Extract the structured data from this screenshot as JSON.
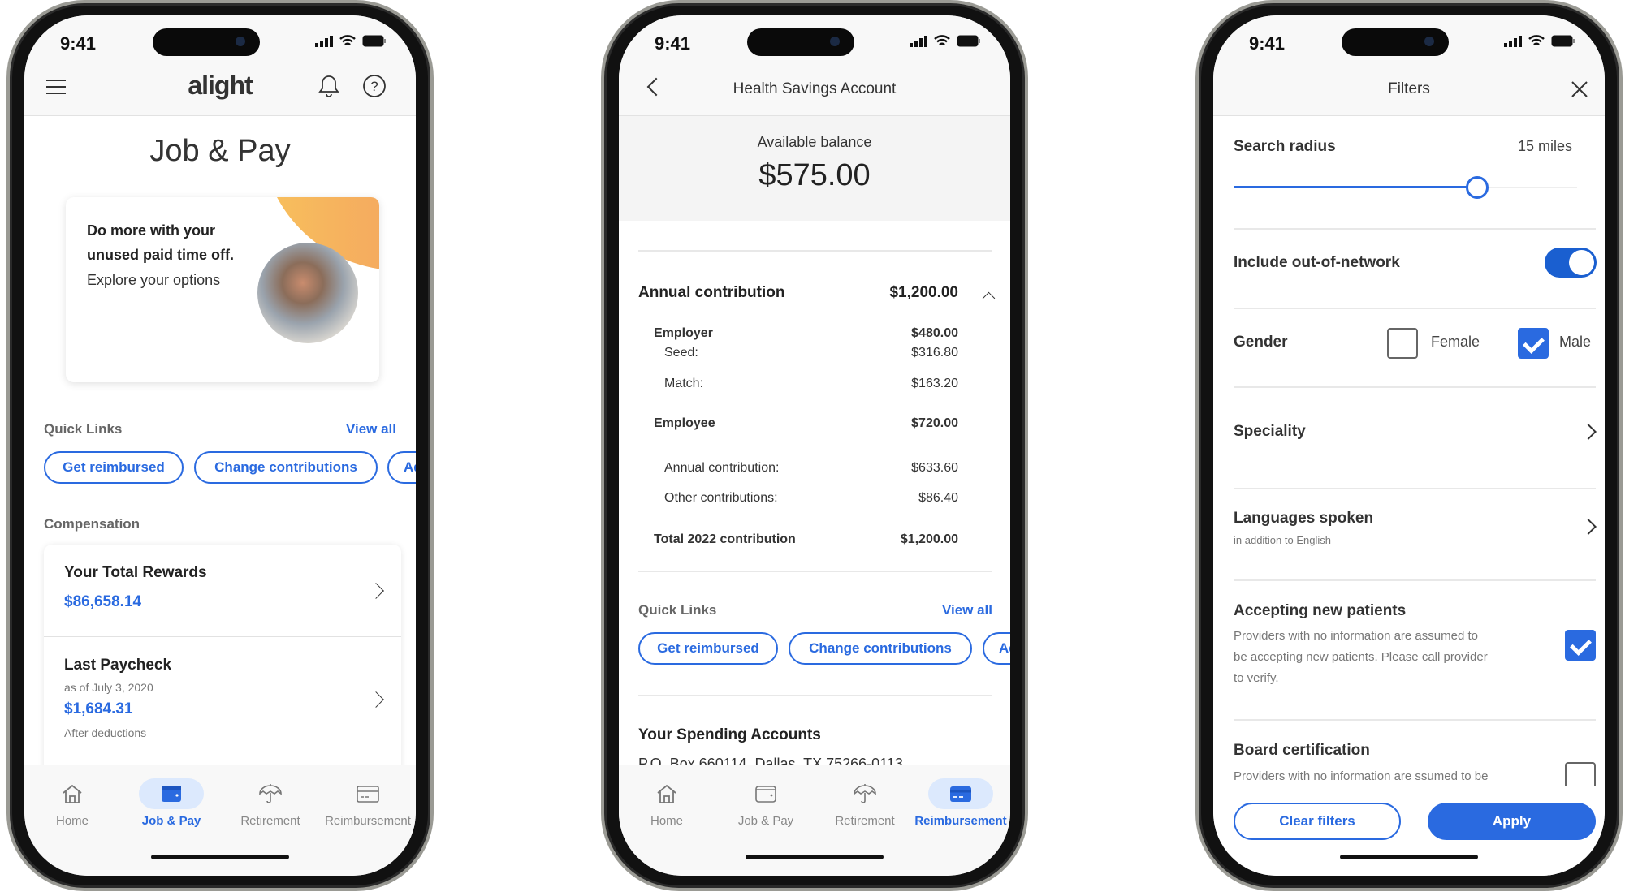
{
  "colors": {
    "accent": "#2a6ae0",
    "toggle": "#1a5fd0",
    "header_bg": "#f8f8f8",
    "promo_orange": "#f6b15a"
  },
  "status_bar": {
    "time": "9:41"
  },
  "nav_items": [
    {
      "label": "Home",
      "icon": "home-icon"
    },
    {
      "label": "Job & Pay",
      "icon": "wallet-icon"
    },
    {
      "label": "Retirement",
      "icon": "umbrella-icon"
    },
    {
      "label": "Reimbursement",
      "icon": "card-icon"
    }
  ],
  "phone1": {
    "logo": "alight",
    "title": "Job & Pay",
    "promo": {
      "headline_line1": "Do more with your",
      "headline_line2": "unused paid time off.",
      "cta": "Explore your options"
    },
    "quick_links": {
      "label": "Quick Links",
      "view_all": "View all",
      "chips": [
        "Get reimbursed",
        "Change contributions",
        "Ad"
      ]
    },
    "compensation": {
      "label": "Compensation",
      "total_rewards": {
        "title": "Your Total Rewards",
        "amount": "$86,658.14"
      },
      "last_paycheck": {
        "title": "Last Paycheck",
        "date": "as of July 3, 2020",
        "amount": "$1,684.31",
        "note": "After deductions"
      }
    },
    "active_nav": "Job & Pay"
  },
  "phone2": {
    "header_title": "Health Savings Account",
    "balance_label": "Available balance",
    "balance": "$575.00",
    "annual": {
      "label": "Annual contribution",
      "value": "$1,200.00",
      "employer": {
        "label": "Employer",
        "value": "$480.00",
        "rows": [
          {
            "label": "Seed:",
            "value": "$316.80"
          },
          {
            "label": "Match:",
            "value": "$163.20"
          }
        ]
      },
      "employee": {
        "label": "Employee",
        "value": "$720.00",
        "rows": [
          {
            "label": "Annual contribution:",
            "value": "$633.60"
          },
          {
            "label": "Other contributions:",
            "value": "$86.40"
          }
        ]
      },
      "total": {
        "label": "Total 2022 contribution",
        "value": "$1,200.00"
      }
    },
    "quick_links": {
      "label": "Quick Links",
      "view_all": "View all",
      "chips": [
        "Get reimbursed",
        "Change contributions",
        "Ad"
      ]
    },
    "spending": {
      "title": "Your Spending Accounts",
      "address": "P.O. Box 660114, Dallas, TX 75266-0113"
    },
    "active_nav": "Reimbursement"
  },
  "phone3": {
    "header_title": "Filters",
    "search_radius": {
      "label": "Search radius",
      "value": "15 miles",
      "slider_fraction": 0.71
    },
    "out_of_network": {
      "label": "Include out-of-network",
      "on": true
    },
    "gender": {
      "label": "Gender",
      "female": "Female",
      "female_checked": false,
      "male": "Male",
      "male_checked": true
    },
    "speciality": {
      "label": "Speciality"
    },
    "languages": {
      "label": "Languages spoken",
      "sub": "in addition to English"
    },
    "accepting": {
      "label": "Accepting new patients",
      "desc": "Providers with no information are assumed to be accepting new patients. Please call provider to verify.",
      "checked": true
    },
    "board": {
      "label": "Board certification",
      "desc": "Providers with no information are ssumed to be",
      "checked": false
    },
    "clear_label": "Clear filters",
    "apply_label": "Apply"
  }
}
